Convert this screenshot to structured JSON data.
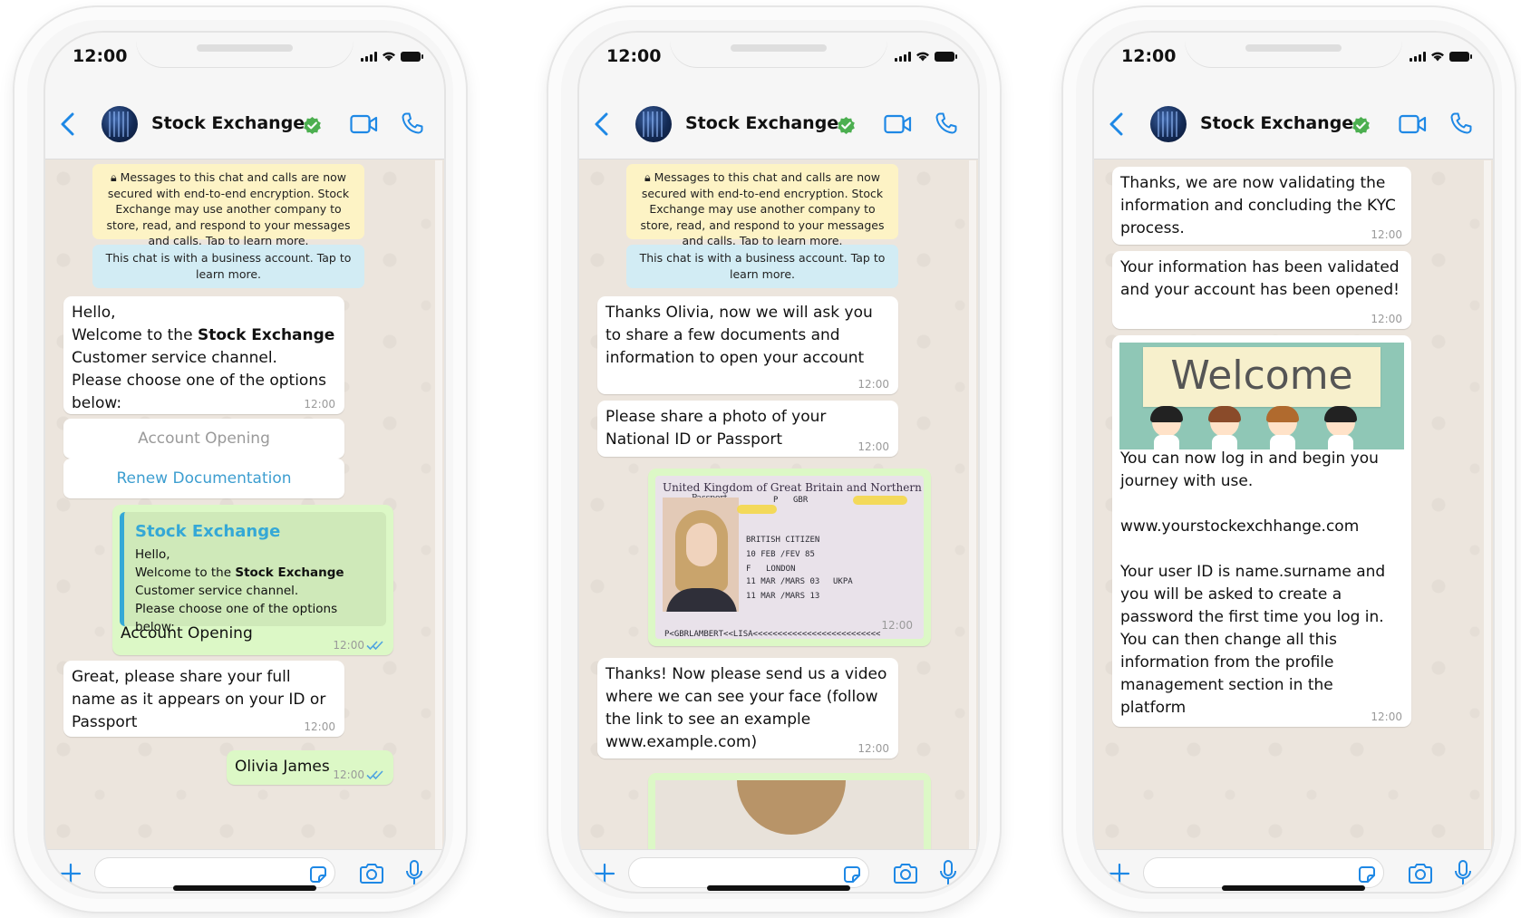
{
  "status": {
    "time": "12:00"
  },
  "contact": {
    "name": "Stock Exchange"
  },
  "notices": {
    "encryption": "Messages to this chat and calls are now secured with end-to-end encryption. Stock Exchange may use another company to store, read, and respond to your messages and calls. Tap to learn more.",
    "business": "This chat is with a business account. Tap to learn more."
  },
  "phone1": {
    "welcome_before": "Hello,\nWelcome to the ",
    "welcome_bold": "Stock Exchange",
    "welcome_after": "\nCustomer service channel.\nPlease choose one of the options below:",
    "welcome_time": "12:00",
    "option_1": "Account Opening",
    "option_2": "Renew Documentation",
    "reply_quote_title": "Stock Exchange",
    "reply_quote_before": "Hello,\nWelcome to the ",
    "reply_quote_bold": "Stock Exchange",
    "reply_quote_after": "\nCustomer service channel.\nPlease choose one of the options below:",
    "reply_text": "Account Opening",
    "reply_time": "12:00",
    "ask_name": "Great, please share your full name as it appears on your ID or Passport",
    "ask_name_time": "12:00",
    "name_reply": "Olivia James",
    "name_reply_time": "12:00"
  },
  "phone2": {
    "msg_1": "Thanks Olivia, now we will ask you to share a few documents and information to open your account",
    "msg_1_time": "12:00",
    "msg_2": "Please share a photo of your National ID or Passport",
    "msg_2_time": "12:00",
    "passport": {
      "header": "United Kingdom of Great Britain and Northern Ireland",
      "label": "Passport",
      "type": "P",
      "country": "GBR",
      "nationality": "BRITISH CITIZEN",
      "dob": "10 FEB /FEV 85",
      "sex": "F",
      "place": "LONDON",
      "issued": "11 MAR /MARS 03",
      "expires": "11 MAR /MARS 13",
      "authority": "UKPA",
      "mrz": "P<GBRLAMBERT<<LISA<<<<<<<<<<<<<<<<<<<<<<<<<<"
    },
    "photo_time": "12:00",
    "msg_3": "Thanks! Now please send us a video where we can see your face (follow the link to see an example www.example.com)",
    "msg_3_time": "12:00"
  },
  "phone3": {
    "msg_1": "Thanks, we are now validating the information and concluding the KYC process.",
    "msg_1_time": "12:00",
    "msg_2": "Your information has been validated and your account has been opened!",
    "msg_2_time": "12:00",
    "banner": "Welcome",
    "msg_3": "You can now log in and begin you journey with use.\n\nwww.yourstockexchhange.com\n\nYour user ID is name.surname and you will be asked to create a password the first time you log in. You can then change all this information from the profile management section in the platform",
    "msg_3_time": "12:00"
  },
  "colors": {
    "accent_blue": "#1e88e5",
    "verified_green": "#4caf50",
    "outgoing_bubble": "#dcf8c6",
    "incoming_bubble": "#ffffff",
    "encryption_notice": "#fdf3c5",
    "business_notice": "#d2ecf4"
  }
}
